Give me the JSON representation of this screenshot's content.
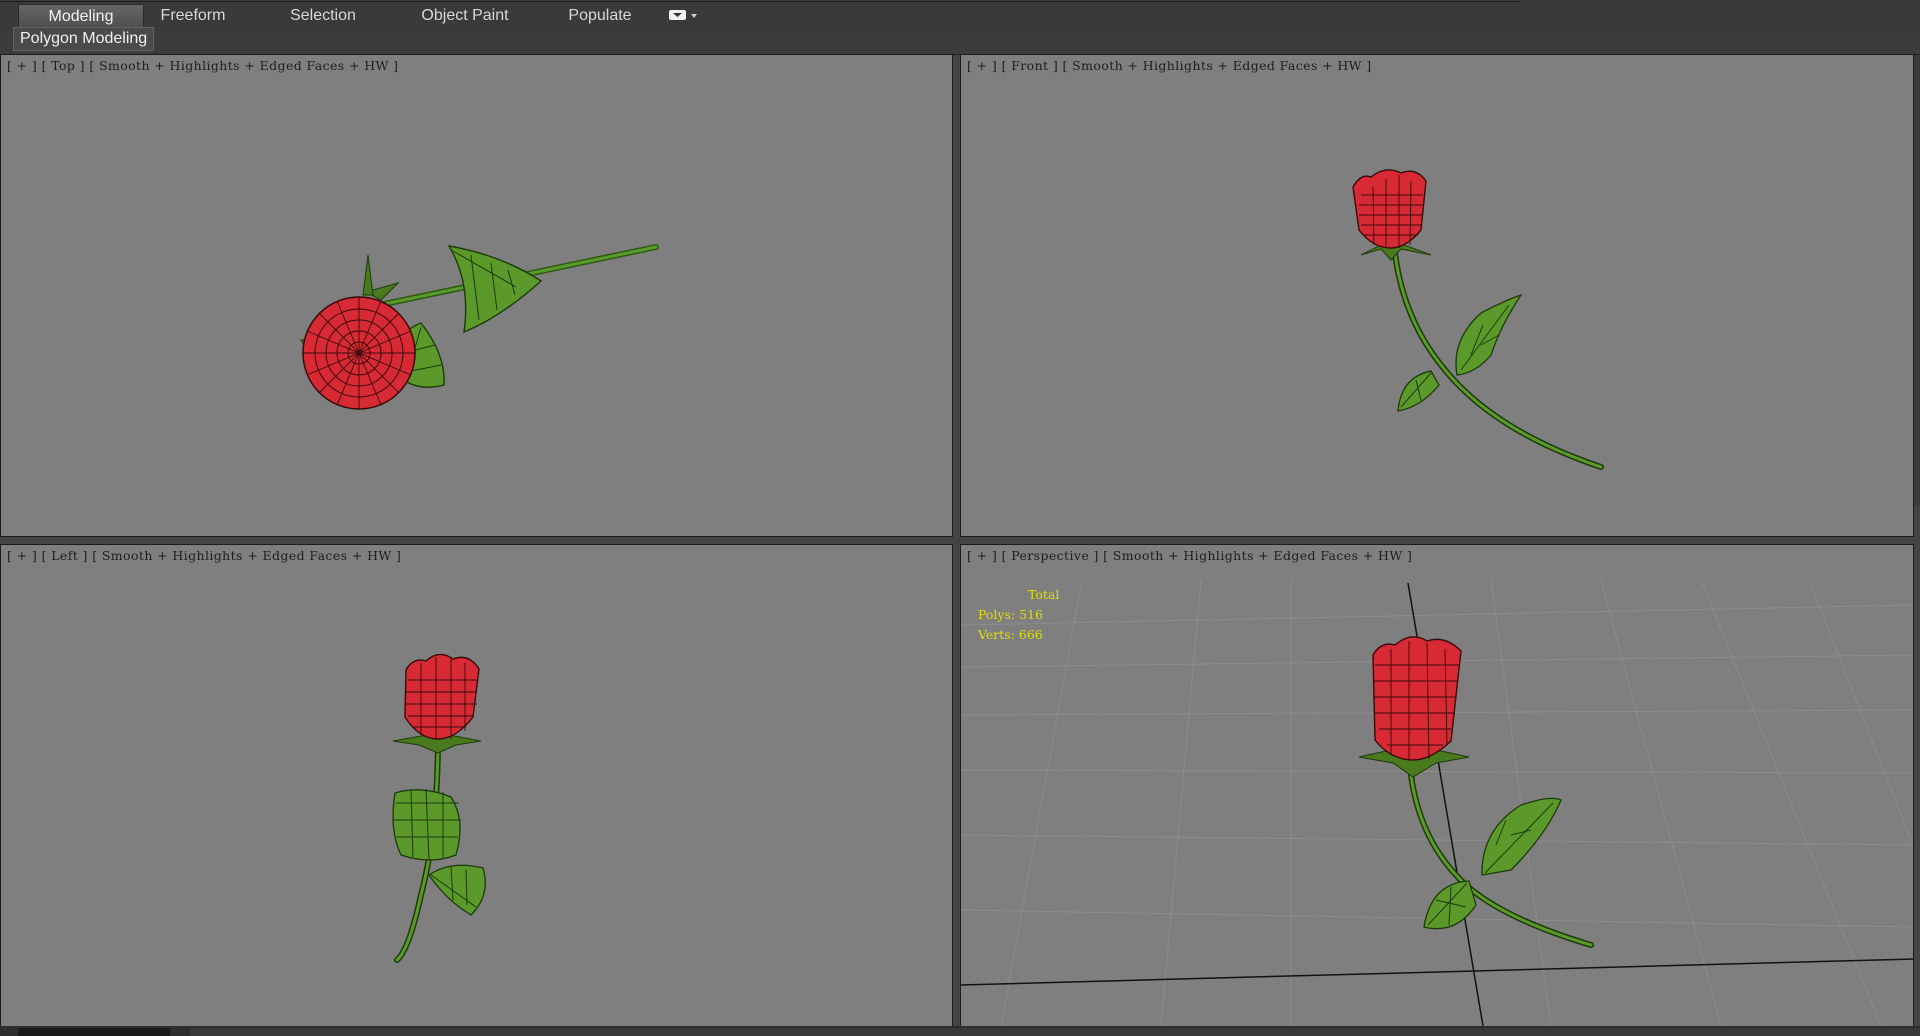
{
  "ribbon": {
    "tabs": [
      {
        "label": "Modeling",
        "active": true
      },
      {
        "label": "Freeform",
        "active": false
      },
      {
        "label": "Selection",
        "active": false
      },
      {
        "label": "Object Paint",
        "active": false
      },
      {
        "label": "Populate",
        "active": false
      }
    ],
    "panel_label": "Polygon Modeling"
  },
  "viewports": {
    "top": {
      "plus": "[ + ]",
      "name": "[ Top ]",
      "shading": "[ Smooth + Highlights + Edged Faces + HW ]"
    },
    "front": {
      "plus": "[ + ]",
      "name": "[ Front ]",
      "shading": "[ Smooth + Highlights + Edged Faces + HW ]"
    },
    "left": {
      "plus": "[ + ]",
      "name": "[ Left ]",
      "shading": "[ Smooth + Highlights + Edged Faces + HW ]"
    },
    "perspective": {
      "plus": "[ + ]",
      "name": "[ Perspective ]",
      "shading": "[ Smooth + Highlights + Edged Faces + HW ]"
    }
  },
  "stats": {
    "total_label": "Total",
    "polys": "Polys: 516",
    "verts": "Verts: 666"
  },
  "colors": {
    "viewport_bg": "#7f7f7f",
    "rose_red": "#e02a36",
    "leaf_green": "#4e8a22",
    "stats_yellow": "#e0e000"
  }
}
